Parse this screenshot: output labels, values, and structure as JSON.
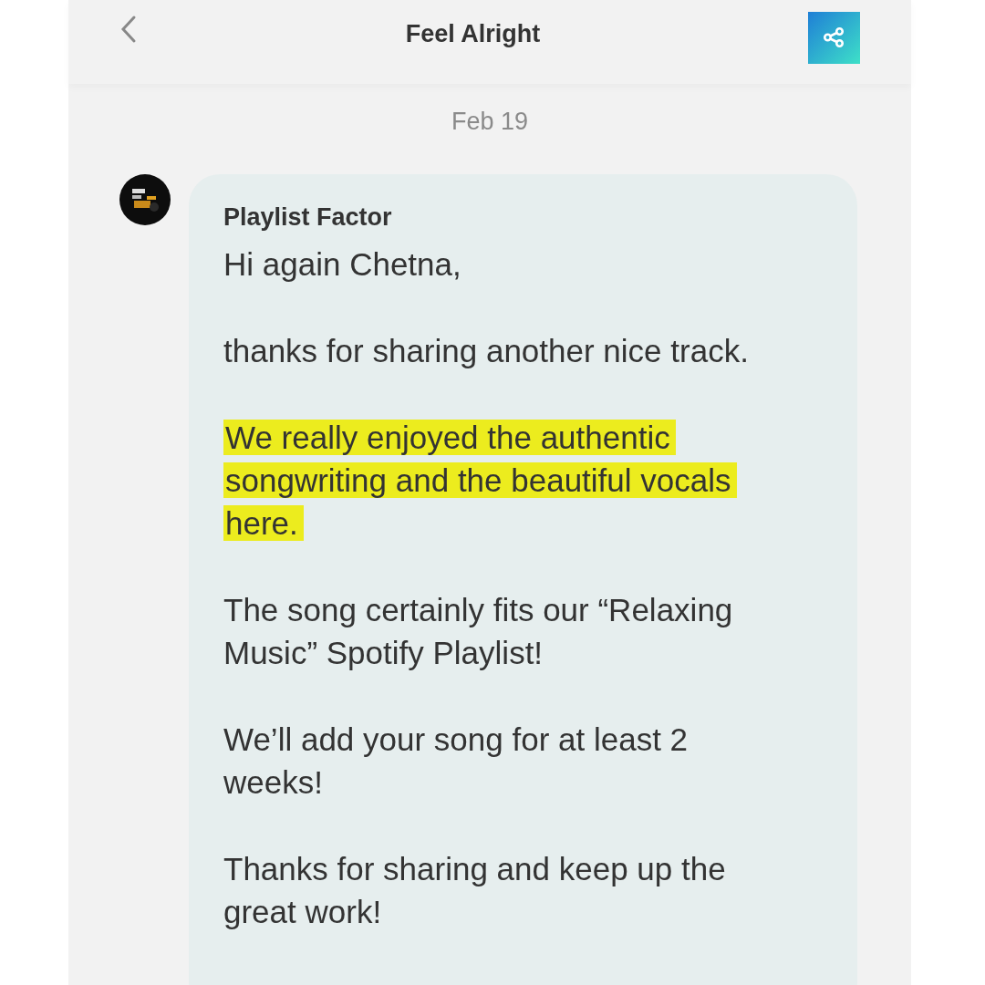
{
  "header": {
    "title": "Feel Alright"
  },
  "date": "Feb 19",
  "message": {
    "sender": "Playlist Factor",
    "paragraphs": [
      {
        "text": "Hi again Chetna,",
        "highlighted": false
      },
      {
        "text": "thanks for sharing another nice track.",
        "highlighted": false
      },
      {
        "text": "We really enjoyed the authentic songwriting and the beautiful vocals here.",
        "highlighted": true
      },
      {
        "text": "The song certainly fits our “Relaxing Music” Spotify Playlist!",
        "highlighted": false
      },
      {
        "text": "We’ll add your song for at least 2 weeks!",
        "highlighted": false
      },
      {
        "text": "Thanks for sharing and keep up the great work!",
        "highlighted": false
      }
    ]
  }
}
